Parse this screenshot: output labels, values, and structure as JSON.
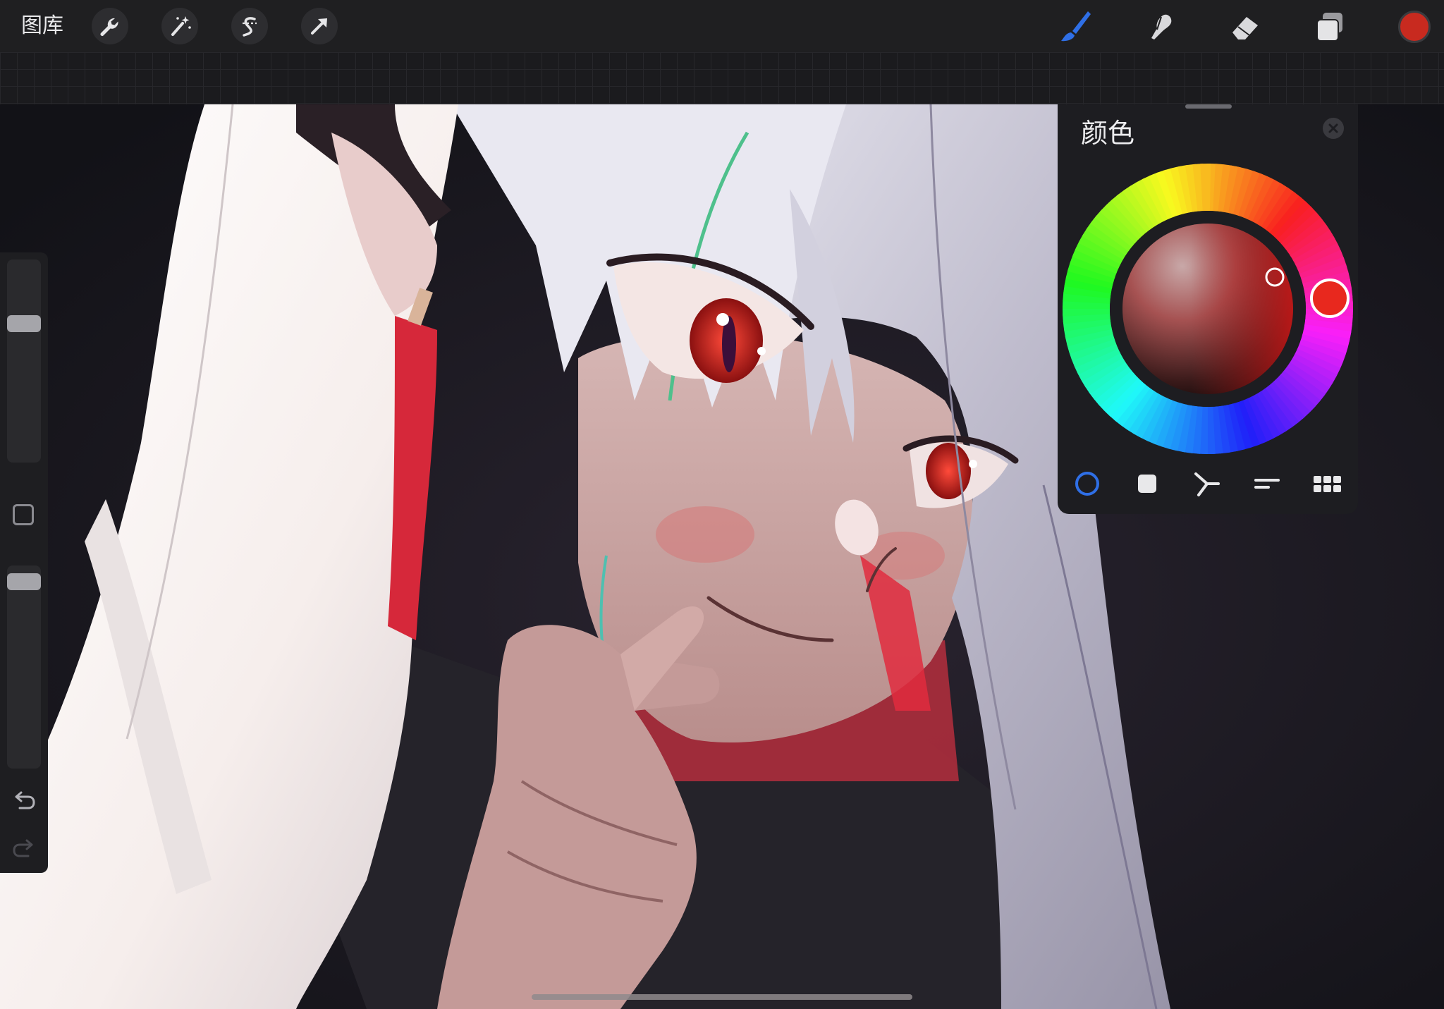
{
  "toolbar": {
    "gallery_label": "图库",
    "left_tools": [
      "wrench-icon",
      "magic-wand-icon",
      "selection-s-icon",
      "transform-arrow-icon"
    ],
    "right_tools": [
      "brush-icon",
      "smudge-icon",
      "eraser-icon",
      "layers-icon"
    ],
    "active_tool": "brush-icon",
    "accent_color": "#2f6fe6",
    "current_color": "#c82a1f"
  },
  "sidebar": {
    "brush_size_level": 0.7,
    "opacity_level": 0.96,
    "icons": [
      "undo-icon",
      "redo-icon"
    ]
  },
  "color_panel": {
    "title": "颜色",
    "mode_tabs": [
      "disc-mode-icon",
      "classic-mode-icon",
      "harmony-mode-icon",
      "value-mode-icon",
      "palettes-mode-icon"
    ],
    "active_mode": "disc-mode-icon",
    "selected_hue_color": "#e8281e"
  },
  "canvas": {
    "artwork": "illustration-image"
  }
}
